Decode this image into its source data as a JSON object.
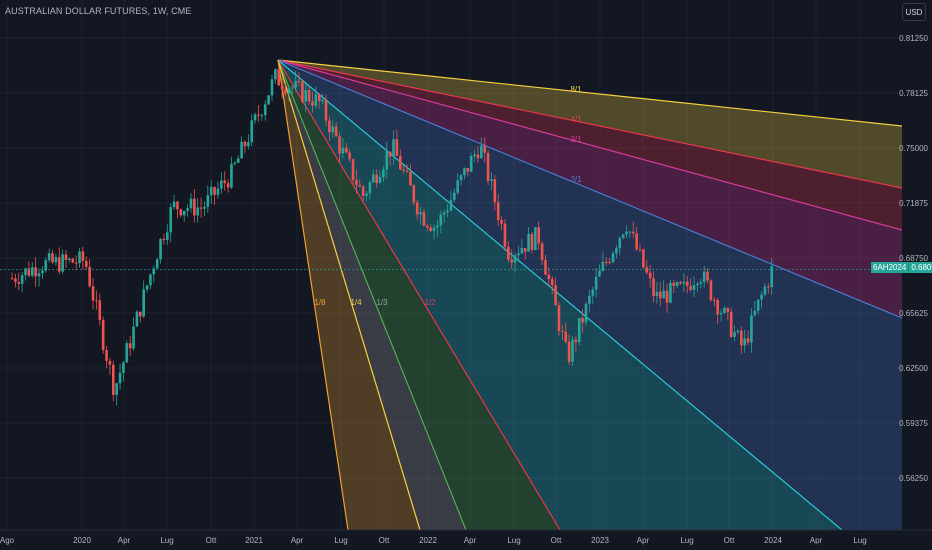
{
  "header": {
    "title": "AUSTRALIAN DOLLAR FUTURES, 1W, CME",
    "currency": "USD"
  },
  "last_price": {
    "symbol": "6AH2024",
    "value": "0.68095"
  },
  "colors": {
    "background": "#131722",
    "grid": "#1e222d",
    "up": "#26a69a",
    "down": "#ef5350",
    "fan_yellow": "#f4d03f",
    "fan_red": "#e8364f",
    "fan_magenta": "#d63a9b",
    "fan_blue": "#4a7bd0",
    "fan_cyan": "#26c6da",
    "fan_green": "#4caf50",
    "fan_gray": "#9e9e9e",
    "fan_orange": "#f0a030"
  },
  "chart_data": {
    "type": "candlestick",
    "title": "AUSTRALIAN DOLLAR FUTURES, 1W, CME",
    "y_axis": {
      "side": "right",
      "ticks": [
        "0.81250",
        "0.78125",
        "0.75000",
        "0.71875",
        "0.68750",
        "0.65625",
        "0.62500",
        "0.59375",
        "0.56250"
      ]
    },
    "x_axis": {
      "ticks": [
        "Ago",
        "2020",
        "Apr",
        "Lug",
        "Ott",
        "2021",
        "Apr",
        "Lug",
        "Ott",
        "2022",
        "Apr",
        "Lug",
        "Ott",
        "2023",
        "Apr",
        "Lug",
        "Ott",
        "2024",
        "Apr",
        "Lug"
      ]
    },
    "last_price": 0.68095,
    "gann_fan": {
      "origin_time": "2021-02",
      "origin_price": 0.8085,
      "labels_right": [
        "8/1",
        "4/1",
        "3/1",
        "2/1"
      ],
      "labels_left": [
        "1/8",
        "1/4",
        "1/3",
        "1/2"
      ]
    },
    "candles_approx": [
      {
        "period": "2019-08",
        "close": 0.676
      },
      {
        "period": "2019-10",
        "close": 0.684
      },
      {
        "period": "2020-01",
        "close": 0.686
      },
      {
        "period": "2020-03",
        "close": 0.613
      },
      {
        "period": "2020-04",
        "close": 0.638
      },
      {
        "period": "2020-06",
        "close": 0.693
      },
      {
        "period": "2020-07",
        "close": 0.717
      },
      {
        "period": "2020-09",
        "close": 0.716
      },
      {
        "period": "2020-11",
        "close": 0.735
      },
      {
        "period": "2021-01",
        "close": 0.772
      },
      {
        "period": "2021-02",
        "close": 0.79
      },
      {
        "period": "2021-05",
        "close": 0.776
      },
      {
        "period": "2021-08",
        "close": 0.723
      },
      {
        "period": "2021-10",
        "close": 0.751
      },
      {
        "period": "2021-12",
        "close": 0.712
      },
      {
        "period": "2022-01",
        "close": 0.705
      },
      {
        "period": "2022-04",
        "close": 0.752
      },
      {
        "period": "2022-06",
        "close": 0.69
      },
      {
        "period": "2022-08",
        "close": 0.7
      },
      {
        "period": "2022-10",
        "close": 0.63
      },
      {
        "period": "2022-12",
        "close": 0.675
      },
      {
        "period": "2023-02",
        "close": 0.708
      },
      {
        "period": "2023-04",
        "close": 0.665
      },
      {
        "period": "2023-06",
        "close": 0.67
      },
      {
        "period": "2023-07",
        "close": 0.68
      },
      {
        "period": "2023-10",
        "close": 0.636
      },
      {
        "period": "2023-11",
        "close": 0.66
      },
      {
        "period": "2023-12",
        "close": 0.681
      }
    ]
  }
}
